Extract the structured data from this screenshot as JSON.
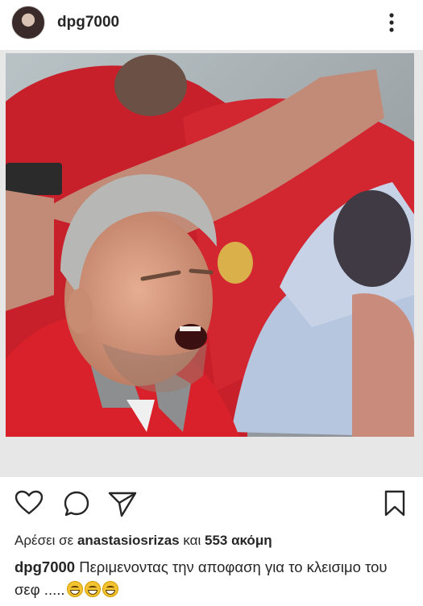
{
  "post": {
    "username": "dpg7000",
    "more_icon": "more-vertical-icon"
  },
  "image": {
    "description_icon": "photo"
  },
  "actions": {
    "like_icon": "heart-icon",
    "comment_icon": "comment-icon",
    "share_icon": "paper-plane-icon",
    "save_icon": "bookmark-icon"
  },
  "likes": {
    "prefix": "Αρέσει σε",
    "user": "anastasiosrizas",
    "and": "και",
    "count": "553 ακόμη"
  },
  "caption": {
    "username": "dpg7000",
    "text": "Περιμενοντας την αποφαση για το κλεισιμο του σεφ .....",
    "emoji": [
      "😂",
      "😂",
      "😂"
    ]
  },
  "colors": {
    "text": "#262626",
    "shirt_red": "#d8212a",
    "photo_bg": "#e7e7e7"
  }
}
